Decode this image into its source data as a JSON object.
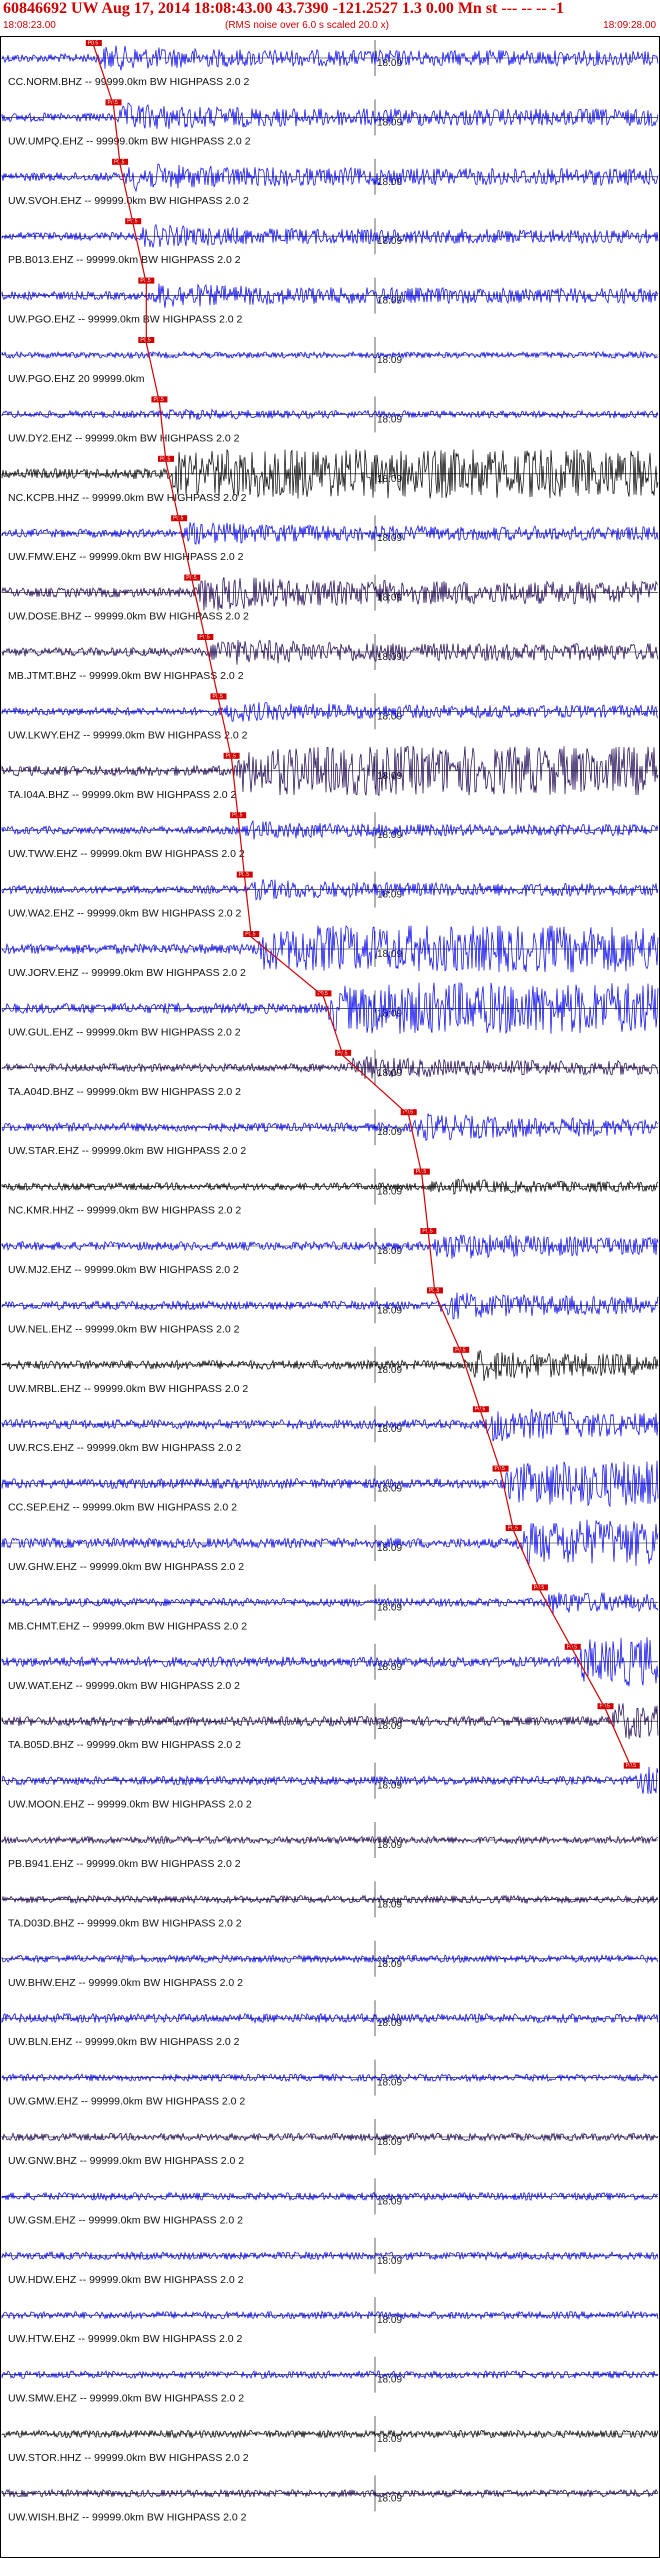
{
  "header": {
    "title": "60846692 UW Aug 17, 2014 18:08:43.00   43.7390 -121.2527  1.3 0.00 Mn st --- -- --  -1",
    "start_time": "18:08:23.00",
    "subtitle": "(RMS noise over 6.0 s scaled 20.0 x)",
    "end_time": "18:09:28.00",
    "pick_label": "P0.5"
  },
  "colors": {
    "red": "#d00000",
    "blue": "#0000ee",
    "dark": "#1a0050",
    "black": "#000000",
    "trace_axis": "#000000"
  },
  "chart_data": {
    "type": "line",
    "xlabel": "",
    "ylabel": "",
    "time_range": [
      "18:08:23.00",
      "18:09:28.00"
    ],
    "tick_label": "18:09",
    "traces": [
      {
        "label": "CC.NORM.BHZ -- 99999.0km BW  HIGHPASS  2.0  2",
        "color": "blue",
        "amp": 0.55,
        "pick": 14
      },
      {
        "label": "UW.UMPQ.EHZ -- 99999.0km BW  HIGHPASS  2.0  2",
        "color": "blue",
        "amp": 0.6,
        "pick": 17
      },
      {
        "label": "UW.SVOH.EHZ -- 99999.0km BW  HIGHPASS  2.0  2",
        "color": "blue",
        "amp": 0.6,
        "pick": 18
      },
      {
        "label": "PB.B013.EHZ -- 99999.0km BW  HIGHPASS  2.0  2",
        "color": "blue",
        "amp": 0.5,
        "pick": 20
      },
      {
        "label": "UW.PGO.EHZ -- 99999.0km BW  HIGHPASS  2.0  2",
        "color": "blue",
        "amp": 0.55,
        "pick": 22
      },
      {
        "label": "UW.PGO.EHZ 20 99999.0km",
        "color": "blue",
        "amp": 0.0,
        "pick": 22
      },
      {
        "label": "UW.DY2.EHZ -- 99999.0km BW  HIGHPASS  2.0  2",
        "color": "blue",
        "amp": 0.25,
        "pick": 24
      },
      {
        "label": "NC.KCPB.HHZ -- 99999.0km BW  HIGHPASS  2.0  2",
        "color": "black",
        "amp": 0.95,
        "pick": 25
      },
      {
        "label": "UW.FMW.EHZ -- 99999.0km BW  HIGHPASS  2.0  2",
        "color": "blue",
        "amp": 0.5,
        "pick": 27
      },
      {
        "label": "UW.DOSE.BHZ -- 99999.0km BW  HIGHPASS  2.0  2",
        "color": "dark",
        "amp": 0.8,
        "pick": 29
      },
      {
        "label": "MB.JTMT.BHZ -- 99999.0km BW  HIGHPASS  2.0  2",
        "color": "dark",
        "amp": 0.6,
        "pick": 31
      },
      {
        "label": "UW.LKWY.EHZ -- 99999.0km BW  HIGHPASS  2.0  2",
        "color": "blue",
        "amp": 0.45,
        "pick": 33
      },
      {
        "label": "TA.I04A.BHZ -- 99999.0km BW  HIGHPASS  2.0  2",
        "color": "dark",
        "amp": 0.95,
        "pick": 35
      },
      {
        "label": "UW.TWW.EHZ -- 99999.0km BW  HIGHPASS  2.0  2",
        "color": "blue",
        "amp": 0.4,
        "pick": 36
      },
      {
        "label": "UW.WA2.EHZ -- 99999.0km BW  HIGHPASS  2.0  2",
        "color": "blue",
        "amp": 0.45,
        "pick": 37
      },
      {
        "label": "UW.JORV.EHZ -- 99999.0km BW  HIGHPASS  2.0  2",
        "color": "blue",
        "amp": 0.9,
        "pick": 38
      },
      {
        "label": "UW.GUL.EHZ -- 99999.0km BW  HIGHPASS  2.0  2",
        "color": "blue",
        "amp": 1.0,
        "pick": 49
      },
      {
        "label": "TA.A04D.BHZ -- 99999.0km BW  HIGHPASS  2.0  2",
        "color": "dark",
        "amp": 0.5,
        "pick": 52
      },
      {
        "label": "UW.STAR.EHZ -- 99999.0km BW  HIGHPASS  2.0  2",
        "color": "blue",
        "amp": 0.6,
        "pick": 62
      },
      {
        "label": "NC.KMR.HHZ -- 99999.0km BW  HIGHPASS  2.0  2",
        "color": "black",
        "amp": 0.35,
        "pick": 64
      },
      {
        "label": "UW.MJ2.EHZ -- 99999.0km BW  HIGHPASS  2.0  2",
        "color": "blue",
        "amp": 0.6,
        "pick": 65
      },
      {
        "label": "UW.NEL.EHZ -- 99999.0km BW  HIGHPASS  2.0  2",
        "color": "blue",
        "amp": 0.6,
        "pick": 66
      },
      {
        "label": "UW.MRBL.EHZ -- 99999.0km BW  HIGHPASS  2.0  2",
        "color": "black",
        "amp": 0.7,
        "pick": 70
      },
      {
        "label": "UW.RCS.EHZ -- 99999.0km BW  HIGHPASS  2.0  2",
        "color": "blue",
        "amp": 0.75,
        "pick": 73
      },
      {
        "label": "CC.SEP.EHZ -- 99999.0km BW  HIGHPASS  2.0  2",
        "color": "blue",
        "amp": 0.9,
        "pick": 76
      },
      {
        "label": "UW.GHW.EHZ -- 99999.0km BW  HIGHPASS  2.0  2",
        "color": "blue",
        "amp": 0.9,
        "pick": 78
      },
      {
        "label": "MB.CHMT.EHZ -- 99999.0km BW  HIGHPASS  2.0  2",
        "color": "blue",
        "amp": 0.5,
        "pick": 82
      },
      {
        "label": "UW.WAT.EHZ -- 99999.0km BW  HIGHPASS  2.0  2",
        "color": "blue",
        "amp": 0.95,
        "pick": 87
      },
      {
        "label": "TA.B05D.BHZ -- 99999.0km BW  HIGHPASS  2.0  2",
        "color": "dark",
        "amp": 0.8,
        "pick": 92
      },
      {
        "label": "UW.MOON.EHZ -- 99999.0km BW  HIGHPASS  2.0  2",
        "color": "blue",
        "amp": 0.6,
        "pick": 96
      },
      {
        "label": "PB.B941.EHZ -- 99999.0km BW  HIGHPASS  2.0  2",
        "color": "dark",
        "amp": 0.25,
        "pick": null
      },
      {
        "label": "TA.D03D.BHZ -- 99999.0km BW  HIGHPASS  2.0  2",
        "color": "dark",
        "amp": 0.3,
        "pick": null
      },
      {
        "label": "UW.BHW.EHZ -- 99999.0km BW  HIGHPASS  2.0  2",
        "color": "blue",
        "amp": 0.3,
        "pick": null
      },
      {
        "label": "UW.BLN.EHZ -- 99999.0km BW  HIGHPASS  2.0  2",
        "color": "blue",
        "amp": 0.7,
        "pick": null
      },
      {
        "label": "UW.GMW.EHZ -- 99999.0km BW  HIGHPASS  2.0  2",
        "color": "blue",
        "amp": 0.2,
        "pick": null
      },
      {
        "label": "UW.GNW.BHZ -- 99999.0km BW  HIGHPASS  2.0  2",
        "color": "dark",
        "amp": 0.3,
        "pick": null
      },
      {
        "label": "UW.GSM.EHZ -- 99999.0km BW  HIGHPASS  2.0  2",
        "color": "blue",
        "amp": 0.35,
        "pick": null
      },
      {
        "label": "UW.HDW.EHZ -- 99999.0km BW  HIGHPASS  2.0  2",
        "color": "blue",
        "amp": 0.35,
        "pick": null
      },
      {
        "label": "UW.HTW.EHZ -- 99999.0km BW  HIGHPASS  2.0  2",
        "color": "blue",
        "amp": 0.3,
        "pick": null
      },
      {
        "label": "UW.SMW.EHZ -- 99999.0km BW  HIGHPASS  2.0  2",
        "color": "blue",
        "amp": 0.3,
        "pick": null
      },
      {
        "label": "UW.STOR.HHZ -- 99999.0km BW  HIGHPASS  2.0  2",
        "color": "black",
        "amp": 0.3,
        "pick": null
      },
      {
        "label": "UW.WISH.BHZ -- 99999.0km BW  HIGHPASS  2.0  2",
        "color": "dark",
        "amp": 0.3,
        "pick": null
      }
    ]
  }
}
